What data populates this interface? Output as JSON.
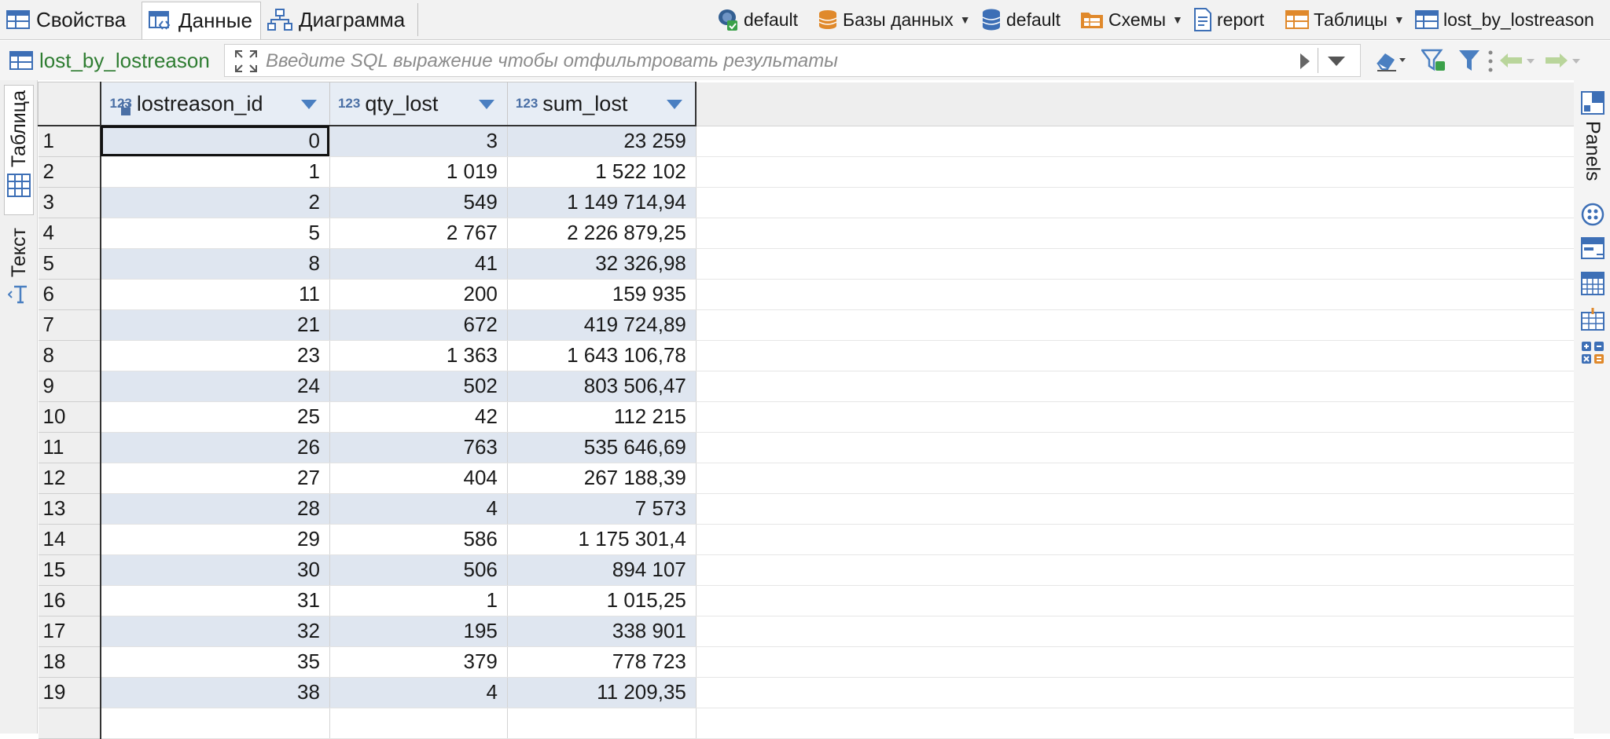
{
  "tabs": [
    {
      "label": "Свойства",
      "icon": "properties-icon",
      "active": false
    },
    {
      "label": "Данные",
      "icon": "data-grid-icon",
      "active": true
    },
    {
      "label": "Диаграмма",
      "icon": "diagram-icon",
      "active": false
    }
  ],
  "breadcrumb": {
    "connection": "default",
    "databases": "Базы данных",
    "database": "default",
    "schemas": "Схемы",
    "schema": "report",
    "tables": "Таблицы",
    "table": "lost_by_lostreason"
  },
  "filter": {
    "table_name": "lost_by_lostreason",
    "placeholder": "Введите SQL выражение чтобы отфильтровать результаты"
  },
  "left_panel": {
    "table_tab": "Таблица",
    "text_tab": "Текст"
  },
  "right_panel": {
    "panels_label": "Panels"
  },
  "colors": {
    "accent": "#4a7fc1",
    "row_alt": "#dfe6f0",
    "header_bg": "#e7edf5",
    "table_name": "#2f7d32"
  },
  "grid": {
    "type_badge": "123",
    "columns": [
      "lostreason_id",
      "qty_lost",
      "sum_lost"
    ],
    "rows": [
      [
        "1",
        "0",
        "3",
        "23 259"
      ],
      [
        "2",
        "1",
        "1 019",
        "1 522 102"
      ],
      [
        "3",
        "2",
        "549",
        "1 149 714,94"
      ],
      [
        "4",
        "5",
        "2 767",
        "2 226 879,25"
      ],
      [
        "5",
        "8",
        "41",
        "32 326,98"
      ],
      [
        "6",
        "11",
        "200",
        "159 935"
      ],
      [
        "7",
        "21",
        "672",
        "419 724,89"
      ],
      [
        "8",
        "23",
        "1 363",
        "1 643 106,78"
      ],
      [
        "9",
        "24",
        "502",
        "803 506,47"
      ],
      [
        "10",
        "25",
        "42",
        "112 215"
      ],
      [
        "11",
        "26",
        "763",
        "535 646,69"
      ],
      [
        "12",
        "27",
        "404",
        "267 188,39"
      ],
      [
        "13",
        "28",
        "4",
        "7 573"
      ],
      [
        "14",
        "29",
        "586",
        "1 175 301,4"
      ],
      [
        "15",
        "30",
        "506",
        "894 107"
      ],
      [
        "16",
        "31",
        "1",
        "1 015,25"
      ],
      [
        "17",
        "32",
        "195",
        "338 901"
      ],
      [
        "18",
        "35",
        "379",
        "778 723"
      ],
      [
        "19",
        "38",
        "4",
        "11 209,35"
      ]
    ]
  }
}
